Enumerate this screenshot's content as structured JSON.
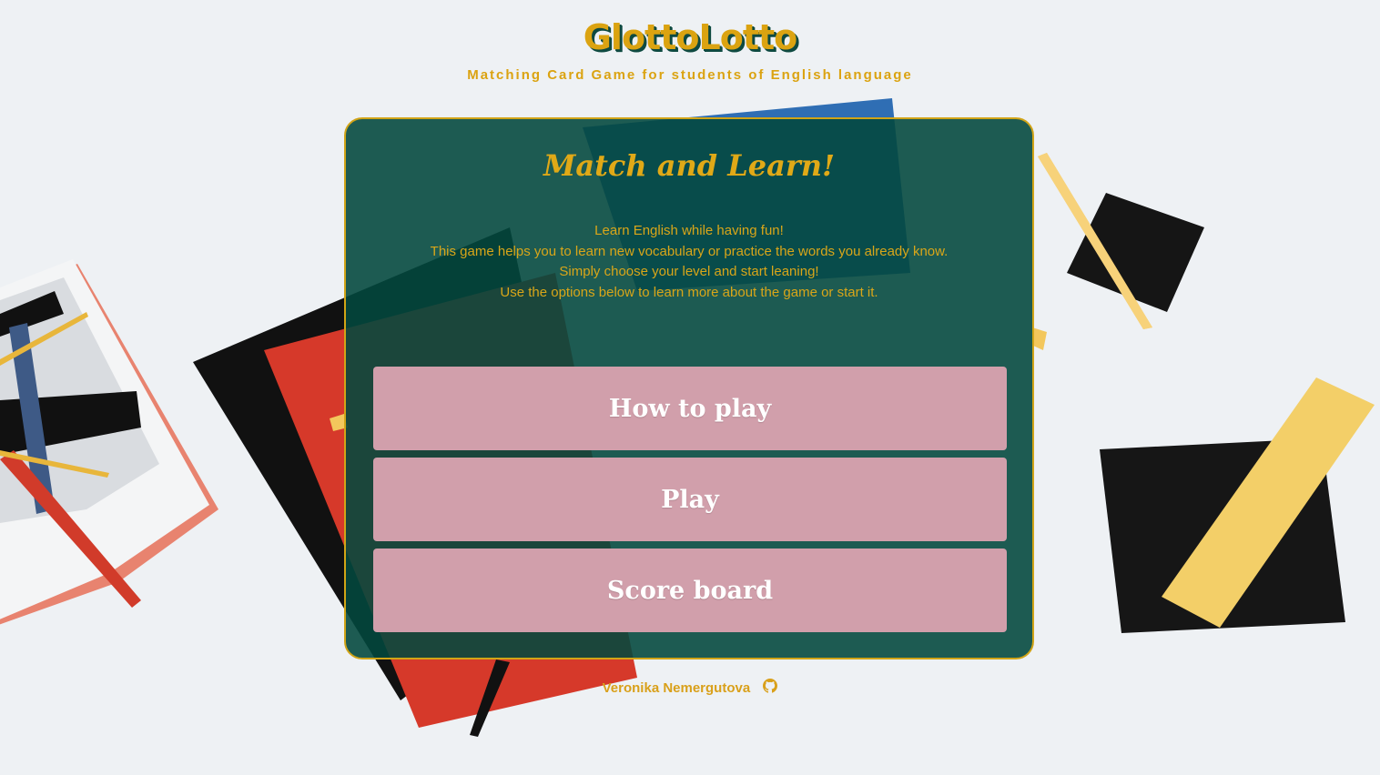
{
  "header": {
    "title": "GlottoLotto",
    "tagline": "Matching Card Game for students of English language"
  },
  "card": {
    "heading": "Match and Learn!",
    "intro": [
      "Learn English while having fun!",
      "This game helps you to learn new vocabulary or practice the words you already know.",
      "Simply choose your level and start leaning!",
      "Use the options below to learn more about the game or start it."
    ],
    "buttons": {
      "how_to_play": "How to play",
      "play": "Play",
      "score_board": "Score board"
    }
  },
  "footer": {
    "author": "Veronika Nemergutova",
    "icon": "github-icon"
  },
  "colors": {
    "accent": "#dba311",
    "card_background": "#03483e",
    "button": "#d19fab",
    "button_text": "#ffffff"
  }
}
